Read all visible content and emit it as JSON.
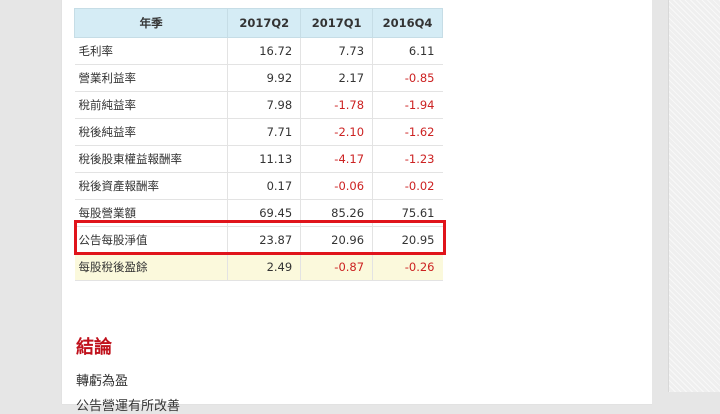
{
  "table": {
    "headers": [
      "年季",
      "2017Q2",
      "2017Q1",
      "2016Q4"
    ],
    "rows": [
      {
        "label": "毛利率",
        "values": [
          "16.72",
          "7.73",
          "6.11"
        ]
      },
      {
        "label": "營業利益率",
        "values": [
          "9.92",
          "2.17",
          "-0.85"
        ]
      },
      {
        "label": "稅前純益率",
        "values": [
          "7.98",
          "-1.78",
          "-1.94"
        ]
      },
      {
        "label": "稅後純益率",
        "values": [
          "7.71",
          "-2.10",
          "-1.62"
        ]
      },
      {
        "label": "稅後股東權益報酬率",
        "values": [
          "11.13",
          "-4.17",
          "-1.23"
        ]
      },
      {
        "label": "稅後資產報酬率",
        "values": [
          "0.17",
          "-0.06",
          "-0.02"
        ]
      },
      {
        "label": "每股營業額",
        "values": [
          "69.45",
          "85.26",
          "75.61"
        ]
      },
      {
        "label": "公告每股淨值",
        "values": [
          "23.87",
          "20.96",
          "20.95"
        ]
      },
      {
        "label": "每股稅後盈餘",
        "values": [
          "2.49",
          "-0.87",
          "-0.26"
        ]
      }
    ]
  },
  "colors": {
    "header_bg": "#d5ecf5",
    "negative": "#cc2222",
    "highlight_border": "#e0141b",
    "highlight_row_bg": "#fbf9dc",
    "heading": "#c0111c"
  },
  "article": {
    "heading": "結論",
    "paragraph_1": "轉虧為盈",
    "paragraph_2": "公告營運有所改善"
  }
}
